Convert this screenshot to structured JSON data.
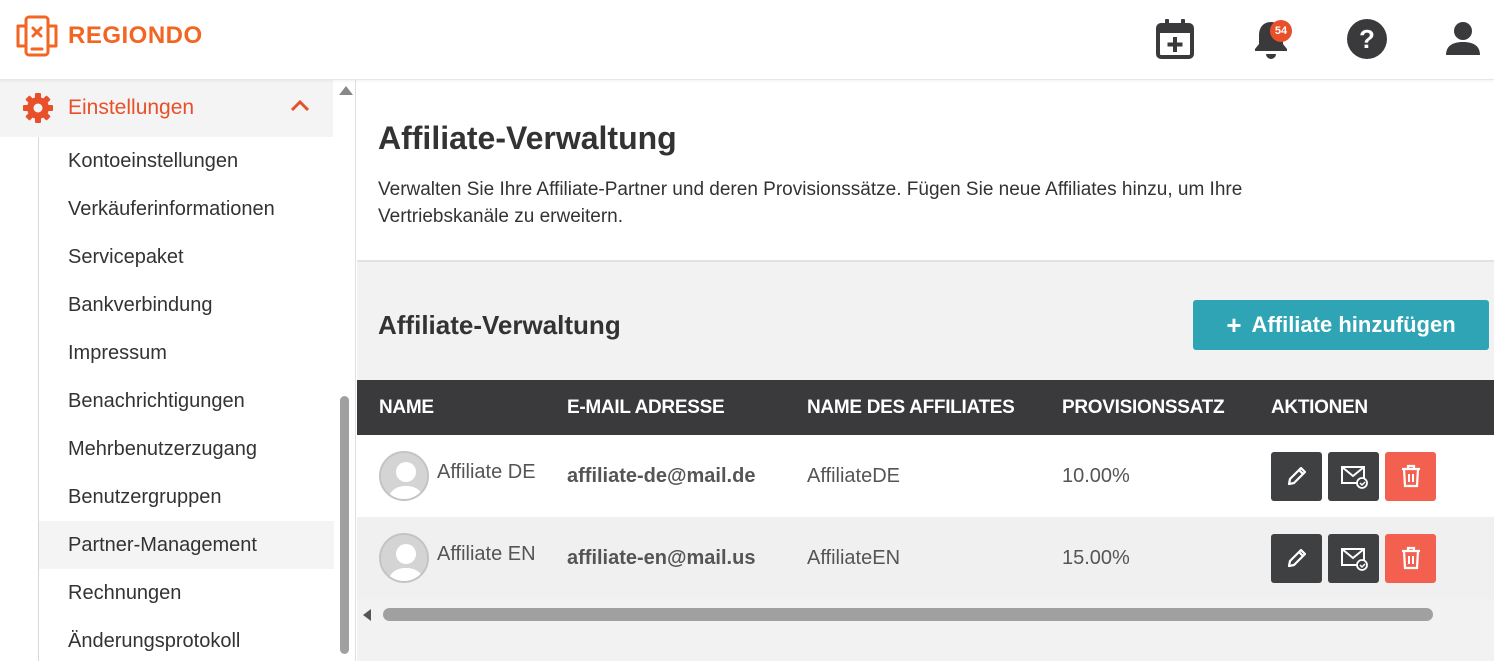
{
  "brand": {
    "name": "REGIONDO",
    "color": "#f26522"
  },
  "header": {
    "icons": [
      "calendar-add-icon",
      "bell-icon",
      "help-icon",
      "user-icon"
    ],
    "notification_count": "54"
  },
  "sidebar": {
    "section": {
      "label": "Einstellungen",
      "icon": "gear-icon",
      "expanded": true
    },
    "items": [
      {
        "label": "Kontoeinstellungen"
      },
      {
        "label": "Verkäuferinformationen"
      },
      {
        "label": "Servicepaket"
      },
      {
        "label": "Bankverbindung"
      },
      {
        "label": "Impressum"
      },
      {
        "label": "Benachrichtigungen"
      },
      {
        "label": "Mehrbenutzerzugang"
      },
      {
        "label": "Benutzergruppen"
      },
      {
        "label": "Partner-Management",
        "active": true
      },
      {
        "label": "Rechnungen"
      },
      {
        "label": "Änderungsprotokoll"
      }
    ]
  },
  "main": {
    "title": "Affiliate-Verwaltung",
    "description": "Verwalten Sie Ihre Affiliate-Partner und deren Provisionssätze. Fügen Sie neue Affiliates hinzu, um Ihre Vertriebskanäle zu erweitern.",
    "section_title": "Affiliate-Verwaltung",
    "add_button": {
      "icon": "+",
      "label": "Affiliate hinzufügen",
      "color": "#2fa4b5"
    },
    "table": {
      "headers": [
        "NAME",
        "E-MAIL ADRESSE",
        "NAME DES AFFILIATES",
        "PROVISIONSSATZ",
        "AKTIONEN"
      ],
      "rows": [
        {
          "name": "Affiliate DE",
          "email": "affiliate-de@mail.de",
          "affiliate_name": "AffiliateDE",
          "commission": "10.00%"
        },
        {
          "name": "Affiliate EN",
          "email": "affiliate-en@mail.us",
          "affiliate_name": "AffiliateEN",
          "commission": "15.00%"
        }
      ],
      "actions": [
        "edit-icon",
        "resend-mail-icon",
        "delete-icon"
      ]
    }
  }
}
